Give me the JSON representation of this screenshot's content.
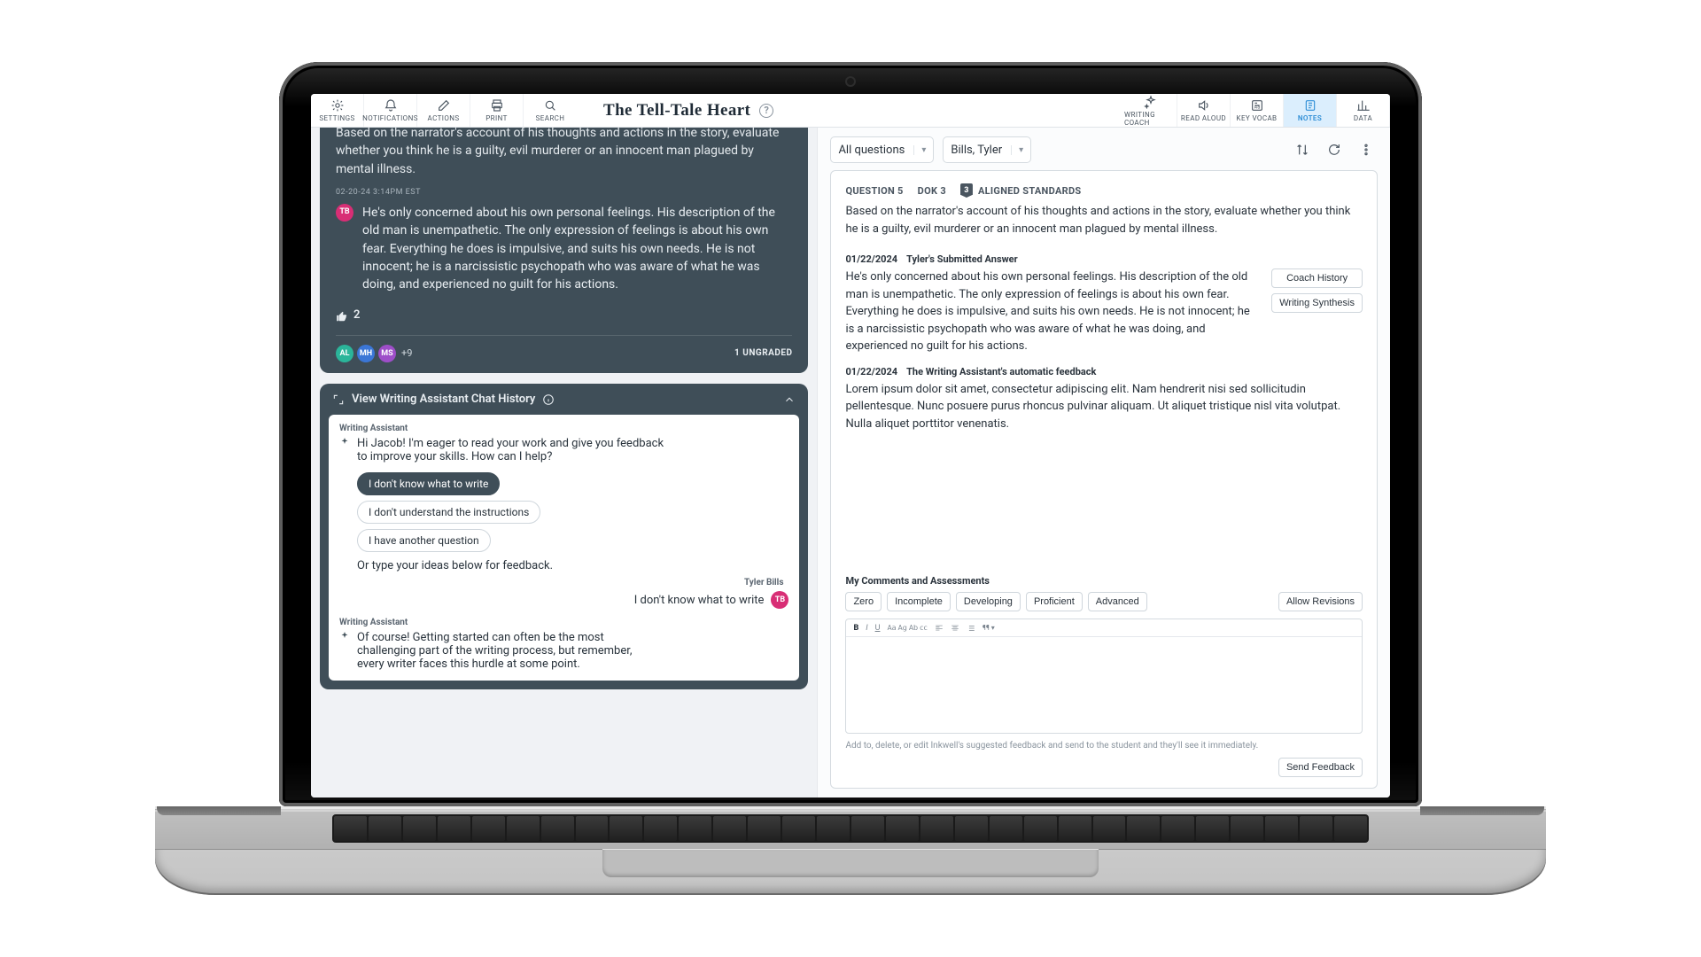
{
  "toolbar": {
    "left": [
      {
        "id": "settings",
        "label": "SETTINGS",
        "icon": "gear"
      },
      {
        "id": "notifications",
        "label": "NOTIFICATIONS",
        "icon": "bell"
      },
      {
        "id": "actions",
        "label": "ACTIONS",
        "icon": "edit"
      },
      {
        "id": "print",
        "label": "PRINT",
        "icon": "print"
      },
      {
        "id": "search",
        "label": "SEARCH",
        "icon": "search"
      }
    ],
    "right": [
      {
        "id": "writing-coach",
        "label": "WRITING COACH",
        "icon": "sparkle"
      },
      {
        "id": "read-aloud",
        "label": "READ ALOUD",
        "icon": "speaker"
      },
      {
        "id": "key-vocab",
        "label": "KEY VOCAB",
        "icon": "vocab"
      },
      {
        "id": "notes",
        "label": "NOTES",
        "icon": "notes",
        "active": true
      },
      {
        "id": "data",
        "label": "DATA",
        "icon": "chart"
      }
    ],
    "title": "The Tell-Tale Heart"
  },
  "left_pane": {
    "prompt": "Based on the narrator's account of his thoughts and actions in the story, evaluate whether you think he is a guilty, evil murderer or an innocent man plagued by mental illness.",
    "timestamp": "02-20-24  3:14PM EST",
    "responder_initials": "TB",
    "responder_color": "pink",
    "answer": "He's only concerned about his own personal feelings. His description of the old man is unempathetic. The only expression of feelings is about his own fear. Everything he does is impulsive, and suits his own needs. He is not innocent; he is a narcissistic psychopath who was aware of what he was doing, and experienced no guilt for his actions.",
    "like_count": "2",
    "responders": [
      {
        "initials": "AL",
        "color": "teal"
      },
      {
        "initials": "MH",
        "color": "blue"
      },
      {
        "initials": "MS",
        "color": "purple"
      }
    ],
    "more_responders": "+9",
    "ungraded": "1 UNGRADED",
    "chat": {
      "header": "View Writing Assistant Chat History",
      "wa_label": "Writing Assistant",
      "greeting": "Hi Jacob! I'm eager to read your work and give you feedback to improve your skills. How can I help?",
      "chips": [
        "I don't know what to write",
        "I don't understand the instructions",
        "I have another question"
      ],
      "or_type": "Or type your ideas below for feedback.",
      "user_name": "Tyler Bills",
      "user_msg": "I don't know what to write",
      "user_initials": "TB",
      "wa_reply": "Of course! Getting started can often be the most challenging part of the writing process, but remember, every writer faces this hurdle at some point."
    }
  },
  "right_pane": {
    "filter_questions": "All questions",
    "filter_student": "Bills, Tyler",
    "question_label": "QUESTION 5",
    "dok_label": "DOK 3",
    "standards_count": "3",
    "standards_label": "ALIGNED STANDARDS",
    "prompt": "Based on the narrator's account of his thoughts and actions in the story, evaluate whether you think he is a guilty, evil murderer or an innocent man plagued by mental illness.",
    "submitted_date": "01/22/2024",
    "submitted_label": "Tyler's Submitted Answer",
    "submitted_text": "He's only concerned about his own personal feelings. His description of the old man is unempathetic. The only expression of feelings is about his own fear. Everything he does is impulsive, and suits his own needs. He is not innocent; he is a narcissistic psychopath who was aware of what he was doing, and experienced no guilt for his actions.",
    "coach_history_btn": "Coach History",
    "writing_synth_btn": "Writing Synthesis",
    "feedback_date": "01/22/2024",
    "feedback_label": "The Writing Assistant's automatic feedback",
    "feedback_text": "Lorem ipsum dolor sit amet, consectetur adipiscing elit. Nam hendrerit nisi sed sollicitudin pellentesque. Nunc posuere purus rhoncus pulvinar aliquam. Ut aliquet tristique nisl vita volutpat. Nulla aliquet porttitor venenatis.",
    "my_comments_label": "My Comments and Assessments",
    "rubric": [
      "Zero",
      "Incomplete",
      "Developing",
      "Proficient",
      "Advanced"
    ],
    "allow_revisions": "Allow Revisions",
    "hint": "Add to, delete, or edit Inkwell's suggested feedback and send to the student and they'll see it immediately.",
    "send_btn": "Send Feedback"
  }
}
